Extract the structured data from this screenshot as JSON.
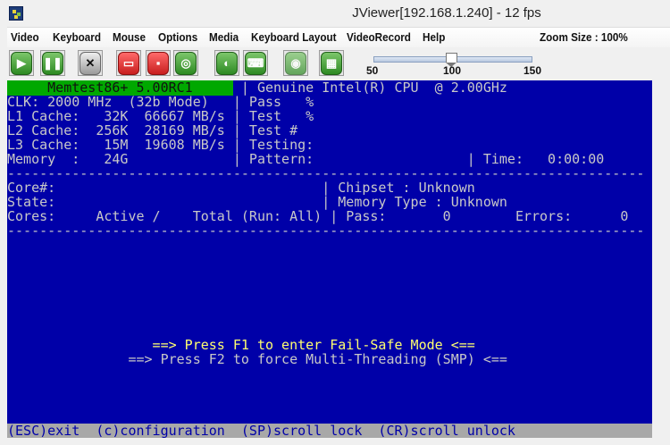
{
  "window": {
    "title": "JViewer[192.168.1.240] - 12 fps"
  },
  "menu": [
    "Video",
    "Keyboard",
    "Mouse",
    "Options",
    "Media",
    "Keyboard Layout",
    "VideoRecord",
    "Help"
  ],
  "zoom_size": "Zoom Size : 100%",
  "toolbar": {
    "buttons": [
      "play-icon",
      "pause-icon",
      "fullscreen-icon",
      "hard-disk-icon",
      "floppy-icon",
      "cd-icon",
      "mouse-icon",
      "keyboard-icon",
      "video-record-icon",
      "hotkeys-icon"
    ],
    "slider": {
      "min_label": "50",
      "mid_label": "100",
      "max_label": "150",
      "value": 100
    }
  },
  "screen": {
    "title": "     Memtest86+ 5.00RC1     ",
    "rows": [
      " | Genuine Intel(R) CPU  @ 2.00GHz",
      "CLK: 2000 MHz  (32b Mode)   | Pass   %",
      "L1 Cache:   32K  66667 MB/s | Test   %",
      "L2 Cache:  256K  28169 MB/s | Test #",
      "L3 Cache:   15M  19608 MB/s | Testing:",
      "Memory  :   24G             | Pattern:                   | Time:   0:00:00",
      "-------------------------------------------------------------------------------",
      "Core#:                                 | Chipset : Unknown",
      "State:                                 | Memory Type : Unknown",
      "Cores:     Active /    Total (Run: All) | Pass:       0        Errors:      0",
      "-------------------------------------------------------------------------------"
    ],
    "f1": "                  ==> Press F1 to enter Fail-Safe Mode <==",
    "f2": "               ==> Press F2 to force Multi-Threading (SMP) <==",
    "status": "(ESC)exit  (c)configuration  (SP)scroll_lock  (CR)scroll_unlock"
  }
}
